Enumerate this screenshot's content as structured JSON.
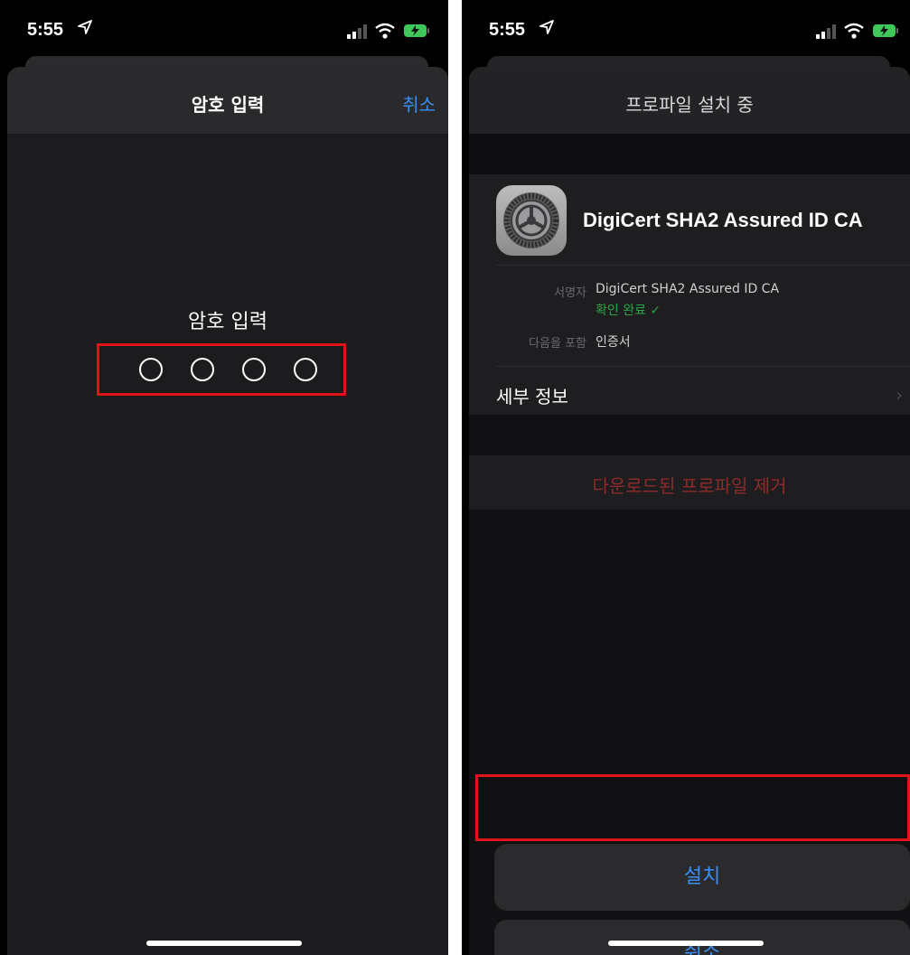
{
  "left_screen": {
    "status": {
      "time": "5:55"
    },
    "nav": {
      "title": "암호 입력",
      "cancel": "취소"
    },
    "passcode": {
      "label": "암호 입력",
      "digits": 4
    }
  },
  "right_screen": {
    "status": {
      "time": "5:55"
    },
    "nav": {
      "title": "프로파일 설치 중"
    },
    "profile": {
      "name": "DigiCert SHA2 Assured ID CA",
      "signed_by_label": "서명자",
      "signed_by_value": "DigiCert SHA2 Assured ID CA",
      "verified": "확인 완료 ✓",
      "contains_label": "다음을 포함",
      "contains_value": "인증서",
      "details_label": "세부 정보"
    },
    "remove_label": "다운로드된 프로파일 제거",
    "buttons": {
      "install": "설치",
      "cancel": "취소"
    }
  },
  "colors": {
    "accent": "#3a8ff5",
    "highlight": "#e1141c",
    "verified": "#2aa546",
    "destructive": "#8e2a2a"
  }
}
